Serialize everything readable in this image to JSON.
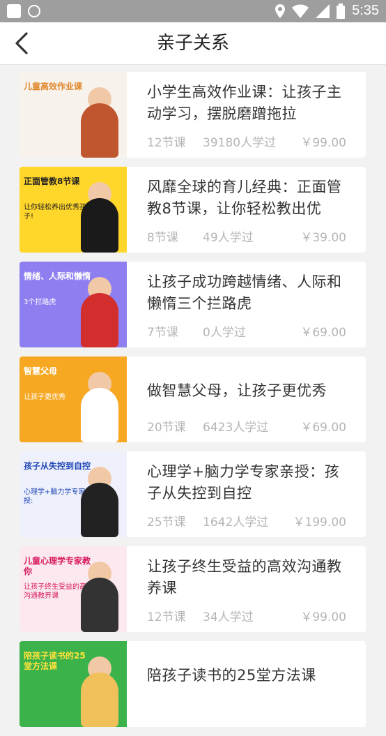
{
  "status": {
    "time": "5:35"
  },
  "nav": {
    "title": "亲子关系"
  },
  "courses": [
    {
      "title": "小学生高效作业课：让孩子主动学习，摆脱磨蹭拖拉",
      "lessons": "12节课",
      "learners": "39180人学过",
      "price": "￥99.00",
      "thumb": {
        "text": "儿童高效作业课",
        "subtext": "",
        "bg": "#f7f3ec",
        "text_color": "#e0862a",
        "person": "#c0562f"
      }
    },
    {
      "title": "风靡全球的育儿经典：正面管教8节课，让你轻松教出优",
      "lessons": "8节课",
      "learners": "49人学过",
      "price": "￥39.00",
      "thumb": {
        "text": "正面管教8节课",
        "subtext": "让你轻松养出优秀孩子!",
        "bg": "#ffd62a",
        "text_color": "#222222",
        "person": "#1a1a1a"
      }
    },
    {
      "title": "让孩子成功跨越情绪、人际和懒惰三个拦路虎",
      "lessons": "7节课",
      "learners": "0人学过",
      "price": "￥69.00",
      "thumb": {
        "text": "情绪、人际和懒惰",
        "subtext": "3个拦路虎",
        "bg": "#8e7ff0",
        "text_color": "#ffffff",
        "person": "#d22e2e"
      }
    },
    {
      "title": "做智慧父母，让孩子更优秀",
      "lessons": "20节课",
      "learners": "6423人学过",
      "price": "￥69.00",
      "thumb": {
        "text": "智慧父母",
        "subtext": "让孩子更优秀",
        "bg": "#f7a823",
        "text_color": "#ffffff",
        "person": "#ffffff"
      }
    },
    {
      "title": "心理学+脑力学专家亲授：孩子从失控到自控",
      "lessons": "25节课",
      "learners": "1642人学过",
      "price": "￥199.00",
      "thumb": {
        "text": "孩子从失控到自控",
        "subtext": "心理学+脑力学专家亲授:",
        "bg": "#eef1fb",
        "text_color": "#2147b8",
        "person": "#222222"
      }
    },
    {
      "title": "让孩子终生受益的高效沟通教养课",
      "lessons": "12节课",
      "learners": "34人学过",
      "price": "￥99.00",
      "thumb": {
        "text": "儿童心理学专家教你",
        "subtext": "让孩子终生受益的高效沟通教养课",
        "bg": "#fbe9ef",
        "text_color": "#d81b60",
        "person": "#333333"
      }
    },
    {
      "title": "陪孩子读书的25堂方法课",
      "lessons": "",
      "learners": "",
      "price": "",
      "thumb": {
        "text": "陪孩子读书的25堂方法课",
        "subtext": "",
        "bg": "#3cb24a",
        "text_color": "#ffe23b",
        "person": "#f0c15a"
      }
    }
  ]
}
